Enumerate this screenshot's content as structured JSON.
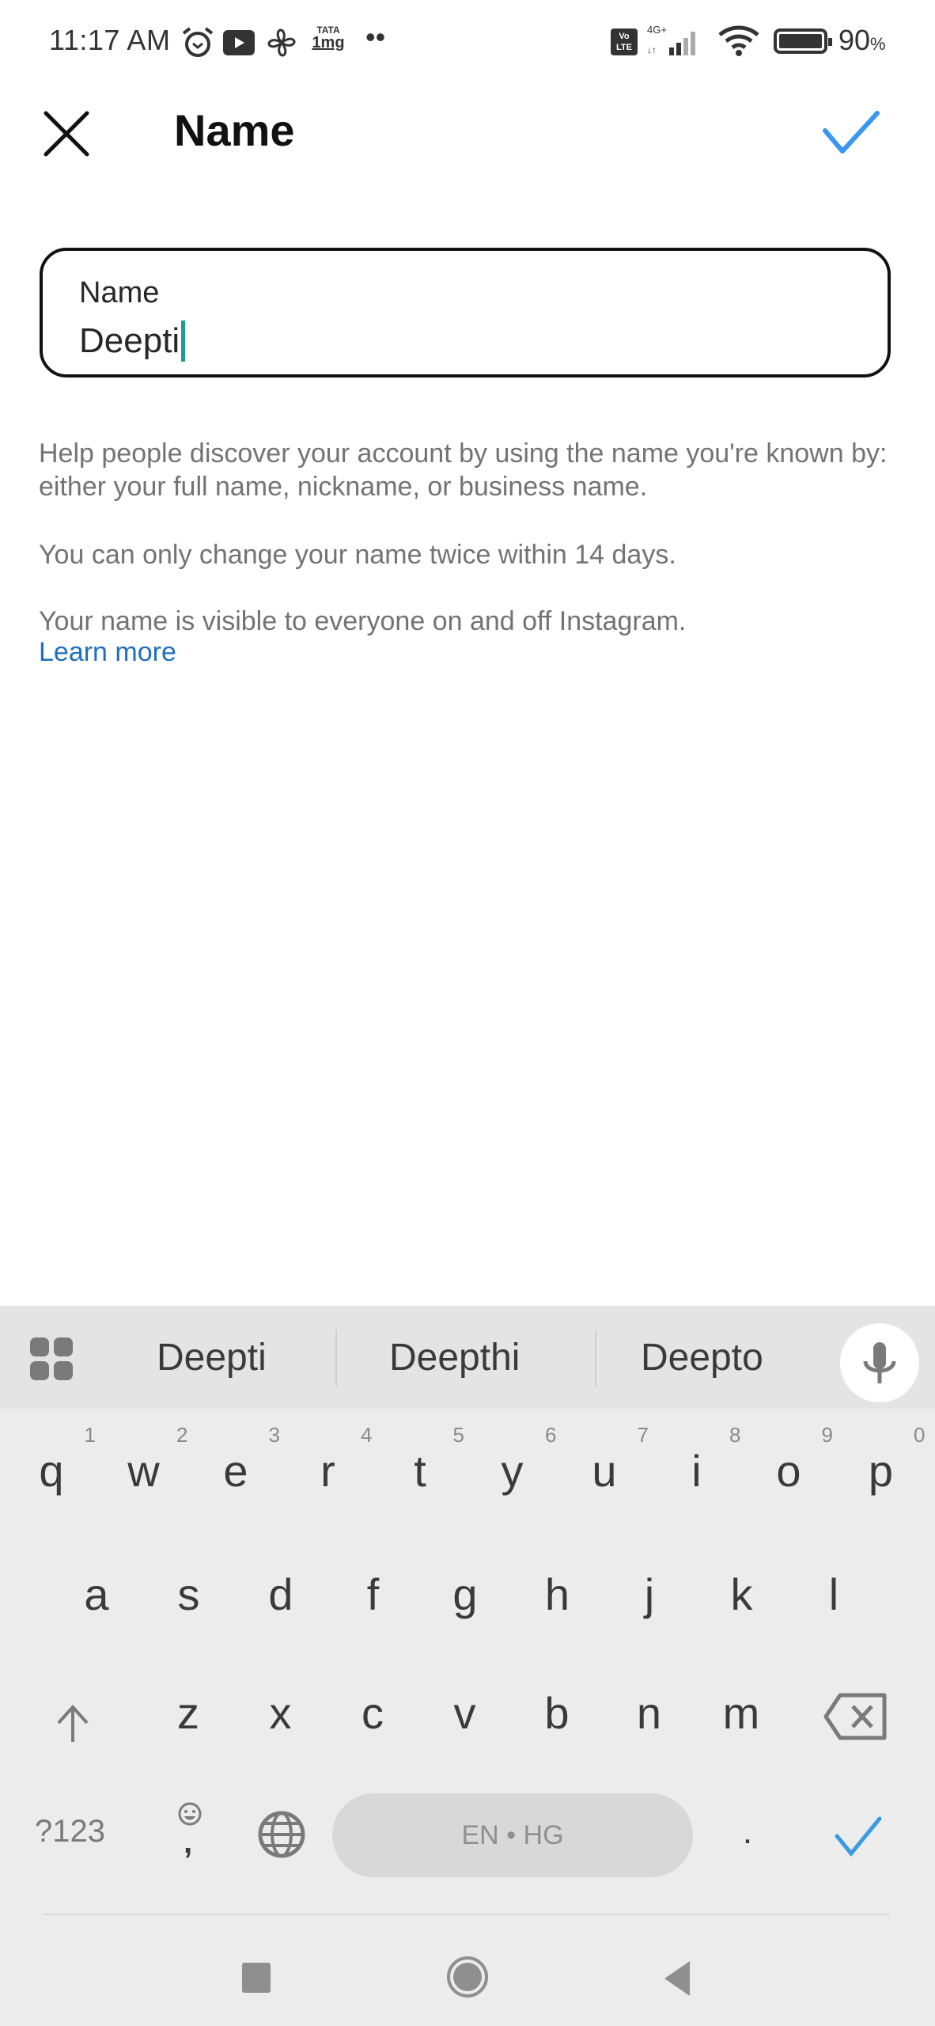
{
  "status_bar": {
    "time": "11:17 AM",
    "left_icons": [
      "alarm-icon",
      "youtube-icon",
      "pinwheel-icon",
      "tata-1mg-icon",
      "more-notifications-icon"
    ],
    "right_icons": [
      "volte-icon",
      "signal-4g-icon",
      "wifi-icon",
      "battery-icon"
    ],
    "network": "4G+",
    "volte": "Vo LTE",
    "battery_percent": "90",
    "battery_suffix": "%"
  },
  "header": {
    "close_icon": "close-icon",
    "title": "Name",
    "done_icon": "check-icon"
  },
  "name_field": {
    "label": "Name",
    "value": "Deepti"
  },
  "help": {
    "line1": "Help people discover your account by using the name you're known by: either your full name, nickname, or business name.",
    "line2": "You can only change your name twice within 14 days.",
    "line3": "Your name is visible to everyone on and off Instagram.",
    "learn_more": "Learn more"
  },
  "keyboard": {
    "suggestions": [
      "Deepti",
      "Deepthi",
      "Deepto"
    ],
    "row1": [
      {
        "k": "q",
        "n": "1"
      },
      {
        "k": "w",
        "n": "2"
      },
      {
        "k": "e",
        "n": "3"
      },
      {
        "k": "r",
        "n": "4"
      },
      {
        "k": "t",
        "n": "5"
      },
      {
        "k": "y",
        "n": "6"
      },
      {
        "k": "u",
        "n": "7"
      },
      {
        "k": "i",
        "n": "8"
      },
      {
        "k": "o",
        "n": "9"
      },
      {
        "k": "p",
        "n": "0"
      }
    ],
    "row2": [
      "a",
      "s",
      "d",
      "f",
      "g",
      "h",
      "j",
      "k",
      "l"
    ],
    "row3": [
      "z",
      "x",
      "c",
      "v",
      "b",
      "n",
      "m"
    ],
    "symbols_label": "?123",
    "comma": ",",
    "space_label": "EN • HG",
    "period": ".",
    "accent_color": "#3a9be0"
  },
  "colors": {
    "accent": "#3897f0",
    "link": "#1f6fbf",
    "caret": "#1b9e8f",
    "keyboard_bg": "#ececec"
  }
}
